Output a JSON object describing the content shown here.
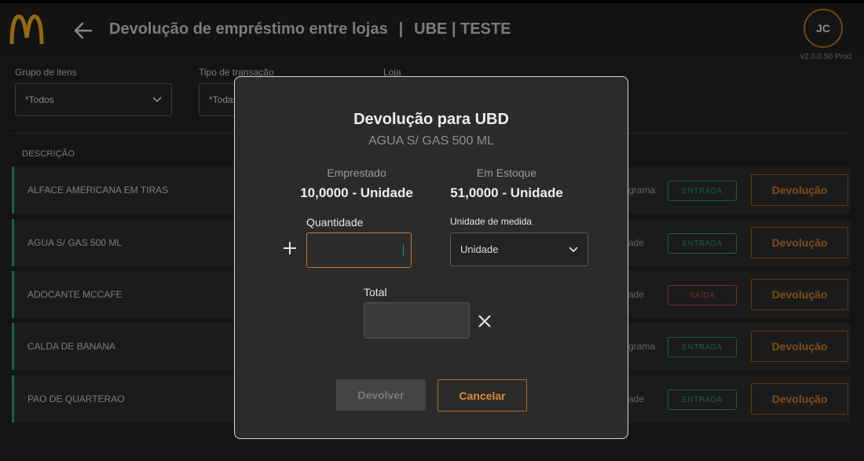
{
  "header": {
    "title": "Devolução de empréstimo entre lojas",
    "separator": "|",
    "store": "UBE | TESTE",
    "user_initials": "JC",
    "version": "v2.0.0.50 Prod"
  },
  "filters": {
    "group_label": "Grupo de itens",
    "group_value": "*Todos",
    "transaction_label": "Tipo de transação",
    "transaction_value": "*Todas",
    "store_label": "Loja"
  },
  "table": {
    "description_header": "DESCRIÇÃO",
    "rows": [
      {
        "description": "ALFACE AMERICANA EM TIRAS",
        "fragment": "grama",
        "status": "ENTRADA",
        "action": "Devolução"
      },
      {
        "description": "AGUA S/ GAS 500 ML",
        "fragment": "ade",
        "status": "ENTRADA",
        "action": "Devolução"
      },
      {
        "description": "ADOCANTE MCCAFE",
        "fragment": "ade",
        "status": "SAÍDA",
        "action": "Devolução"
      },
      {
        "description": "CALDA DE BANANA",
        "fragment": "grama",
        "status": "ENTRADA",
        "action": "Devolução"
      },
      {
        "description": "PAO DE QUARTERAO",
        "fragment": "ade",
        "status": "ENTRADA",
        "action": "Devolução"
      }
    ]
  },
  "modal": {
    "title": "Devolução para UBD",
    "subtitle": "AGUA S/ GAS 500 ML",
    "borrowed_label": "Emprestado",
    "borrowed_value": "10,0000 - Unidade",
    "stock_label": "Em Estoque",
    "stock_value": "51,0000 - Unidade",
    "quantity_label": "Quantidade",
    "quantity_value": "",
    "unit_label": "Unidade de medida",
    "unit_value": "Unidade",
    "total_label": "Total",
    "total_value": "",
    "return_button": "Devolver",
    "cancel_button": "Cancelar"
  },
  "colors": {
    "accent": "#c4762a",
    "entrada": "#1e9a63",
    "saida": "#b14b4b",
    "logo": "#e0a21a"
  }
}
